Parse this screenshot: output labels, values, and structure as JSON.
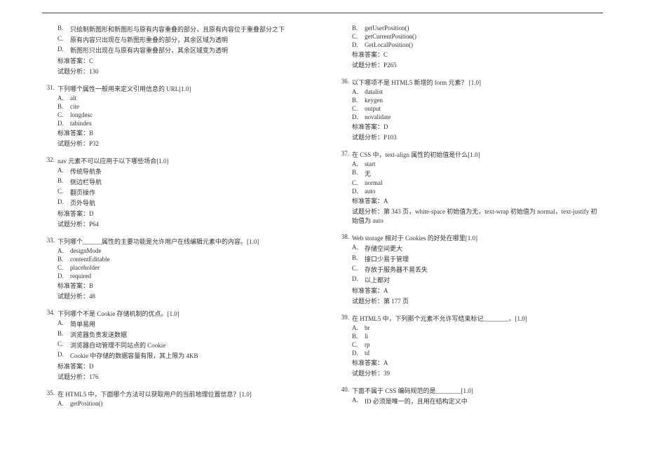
{
  "labels": {
    "answer_prefix": "标准答案：",
    "analysis_prefix": "试题分析："
  },
  "left": [
    {
      "num": "",
      "text": "",
      "opts": [
        {
          "l": "B.",
          "t": "只绘制新图形和新图形与原有内容重叠的部分，且原有内容位于重叠部分之下"
        },
        {
          "l": "C.",
          "t": "原有内容只出现在与新图形重叠的部分，其余区域为透明"
        },
        {
          "l": "D.",
          "t": "新图形只出现在与原有内容重叠部分，其余区域变为透明"
        }
      ],
      "answer": "C",
      "analysis": "130"
    },
    {
      "num": "31.",
      "text": "下列哪个属性一般用来定义引用信息的 URL[1.0]",
      "opts": [
        {
          "l": "A.",
          "t": "alt"
        },
        {
          "l": "B.",
          "t": "cite"
        },
        {
          "l": "C.",
          "t": "longdesc"
        },
        {
          "l": "D.",
          "t": "tabindex"
        }
      ],
      "answer": "B",
      "analysis": "P32"
    },
    {
      "num": "32.",
      "text": "nav 元素不可以应用于以下哪些场合[1.0]",
      "opts": [
        {
          "l": "A.",
          "t": "传统导航条"
        },
        {
          "l": "B.",
          "t": "侧边栏导航"
        },
        {
          "l": "C.",
          "t": "翻页操作"
        },
        {
          "l": "D.",
          "t": "页外导航"
        }
      ],
      "answer": "D",
      "analysis": "P64"
    },
    {
      "num": "33.",
      "text": "下列哪个______属性的主要功能是允许用户在线编辑元素中的内容。[1.0]",
      "opts": [
        {
          "l": "A.",
          "t": "designMode"
        },
        {
          "l": "B.",
          "t": "contentEditable"
        },
        {
          "l": "C.",
          "t": "placeholder"
        },
        {
          "l": "D.",
          "t": "required"
        }
      ],
      "answer": "B",
      "analysis": "48"
    },
    {
      "num": "34.",
      "text": "下列哪个不是 Cookie 存储机制的优点。[1.0]",
      "opts": [
        {
          "l": "A.",
          "t": "简单易用"
        },
        {
          "l": "B.",
          "t": "浏览器负责发送数据"
        },
        {
          "l": "C.",
          "t": "浏览器自动管理不同站点的 Cookie"
        },
        {
          "l": "D.",
          "t": "Cookie 中存储的数据容量有限，其上限为 4KB"
        }
      ],
      "answer": "D",
      "analysis": "176"
    },
    {
      "num": "35.",
      "text": "在 HTML5 中，下面哪个方法可以获取用户的当前地理位置信息？[1.0]",
      "opts": [
        {
          "l": "A.",
          "t": "getPosition()"
        }
      ]
    }
  ],
  "right": [
    {
      "num": "",
      "text": "",
      "opts": [
        {
          "l": "B.",
          "t": "getUserPosition()"
        },
        {
          "l": "C.",
          "t": "getCurrentPosition()"
        },
        {
          "l": "D.",
          "t": "GetLocalPosition()"
        }
      ],
      "answer": "C",
      "analysis": "P265"
    },
    {
      "num": "36.",
      "text": "以下哪项不是 HTML5 新增的 form 元素？ [1.0]",
      "opts": [
        {
          "l": "A.",
          "t": "datalist"
        },
        {
          "l": "B.",
          "t": "keygen"
        },
        {
          "l": "C.",
          "t": "output"
        },
        {
          "l": "D.",
          "t": "novalidate"
        }
      ],
      "answer": "D",
      "analysis": "P103"
    },
    {
      "num": "37.",
      "text": "在 CSS 中，text-align 属性的初始值是什么[1.0]",
      "opts": [
        {
          "l": "A.",
          "t": "start"
        },
        {
          "l": "B.",
          "t": "无"
        },
        {
          "l": "C.",
          "t": "normal"
        },
        {
          "l": "D.",
          "t": "auto"
        }
      ],
      "answer": "A",
      "analysis": "第 343 页，white-space 初始值为无，text-wrap 初始值为 normal，text-justify 初始值为 auto"
    },
    {
      "num": "38.",
      "text": "Web storage 相对于 Cookies 的好处在哪里[1.0]",
      "opts": [
        {
          "l": "A.",
          "t": "存储空间更大"
        },
        {
          "l": "B.",
          "t": "接口少易于管理"
        },
        {
          "l": "C.",
          "t": "存放于服务器不易丢失"
        },
        {
          "l": "D.",
          "t": "以上都对"
        }
      ],
      "answer": "A",
      "analysis": "第 177 页"
    },
    {
      "num": "39.",
      "text": "在 HTML5 中，下列那个元素不允许写结束标记________。[1.0]",
      "opts": [
        {
          "l": "A.",
          "t": "br"
        },
        {
          "l": "B.",
          "t": "li"
        },
        {
          "l": "C.",
          "t": "rp"
        },
        {
          "l": "D.",
          "t": "td"
        }
      ],
      "answer": "A",
      "analysis": "39"
    },
    {
      "num": "40.",
      "text": "下面不属于 CSS 编码规范的是________[1.0]",
      "opts": [
        {
          "l": "A.",
          "t": "ID 必须是唯一的，且用在结构定义中"
        }
      ]
    }
  ]
}
